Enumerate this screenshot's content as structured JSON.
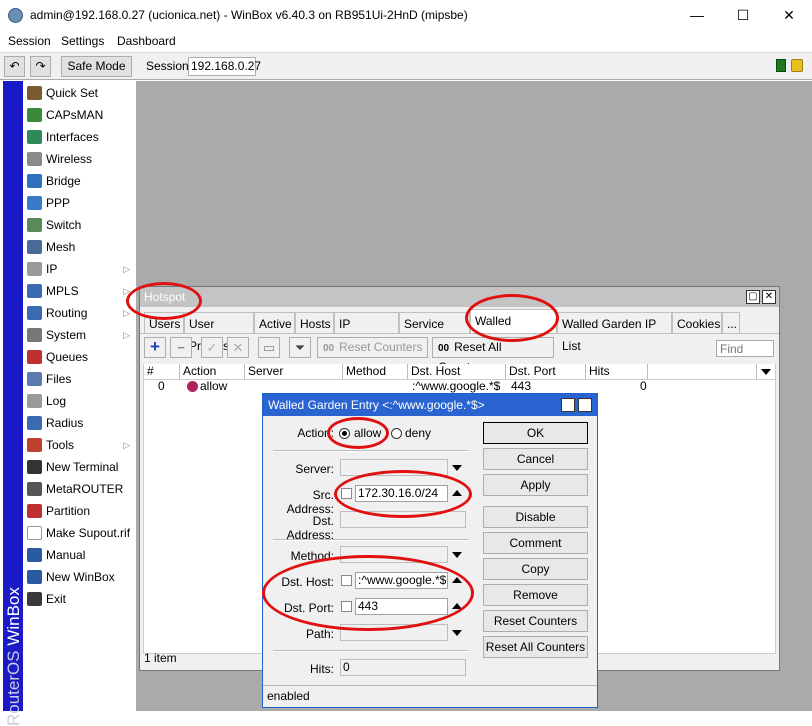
{
  "window": {
    "title": "admin@192.168.0.27 (ucionica.net) - WinBox v6.40.3 on RB951Ui-2HnD (mipsbe)",
    "minimize": "—",
    "maximize": "☐",
    "close": "✕"
  },
  "menubar": [
    "Session",
    "Settings",
    "Dashboard"
  ],
  "toolbar": {
    "undo": "↶",
    "redo": "↷",
    "safe_mode": "Safe Mode",
    "session_label": "Session:",
    "session_value": "192.168.0.27"
  },
  "sidebar": {
    "brand_a": "RouterOS ",
    "brand_b": "WinBox",
    "items": [
      {
        "label": "Quick Set",
        "icon": "quick-set-icon",
        "color": "#7a5a30",
        "submenu": false
      },
      {
        "label": "CAPsMAN",
        "icon": "capsman-icon",
        "color": "#3a8a3a",
        "submenu": false
      },
      {
        "label": "Interfaces",
        "icon": "interfaces-icon",
        "color": "#2e8b57",
        "submenu": false
      },
      {
        "label": "Wireless",
        "icon": "wireless-icon",
        "color": "#8a8a8a",
        "submenu": false
      },
      {
        "label": "Bridge",
        "icon": "bridge-icon",
        "color": "#3070c0",
        "submenu": false
      },
      {
        "label": "PPP",
        "icon": "ppp-icon",
        "color": "#3a7acb",
        "submenu": false
      },
      {
        "label": "Switch",
        "icon": "switch-icon",
        "color": "#5a8a5a",
        "submenu": false
      },
      {
        "label": "Mesh",
        "icon": "mesh-icon",
        "color": "#4a6a9a",
        "submenu": false
      },
      {
        "label": "IP",
        "icon": "ip-icon",
        "color": "#9a9a9a",
        "submenu": true
      },
      {
        "label": "MPLS",
        "icon": "mpls-icon",
        "color": "#3a6ab0",
        "submenu": true
      },
      {
        "label": "Routing",
        "icon": "routing-icon",
        "color": "#3a6ab0",
        "submenu": true
      },
      {
        "label": "System",
        "icon": "gear-icon",
        "color": "#777777",
        "submenu": true
      },
      {
        "label": "Queues",
        "icon": "queues-icon",
        "color": "#c03030",
        "submenu": false
      },
      {
        "label": "Files",
        "icon": "files-icon",
        "color": "#5a7ab0",
        "submenu": false
      },
      {
        "label": "Log",
        "icon": "log-icon",
        "color": "#9a9a9a",
        "submenu": false
      },
      {
        "label": "Radius",
        "icon": "radius-icon",
        "color": "#3a6ab0",
        "submenu": false
      },
      {
        "label": "Tools",
        "icon": "tools-icon",
        "color": "#c04030",
        "submenu": true
      },
      {
        "label": "New Terminal",
        "icon": "terminal-icon",
        "color": "#333333",
        "submenu": false
      },
      {
        "label": "MetaROUTER",
        "icon": "metarouter-icon",
        "color": "#555555",
        "submenu": false
      },
      {
        "label": "Partition",
        "icon": "partition-icon",
        "color": "#c03030",
        "submenu": false
      },
      {
        "label": "Make Supout.rif",
        "icon": "supout-icon",
        "color": "#ffffff",
        "submenu": false
      },
      {
        "label": "Manual",
        "icon": "manual-icon",
        "color": "#2a5aa0",
        "submenu": false
      },
      {
        "label": "New WinBox",
        "icon": "winbox-icon",
        "color": "#2a5aa0",
        "submenu": false
      },
      {
        "label": "Exit",
        "icon": "exit-icon",
        "color": "#3a3a3a",
        "submenu": false
      }
    ]
  },
  "hotspot": {
    "title": "Hotspot",
    "tabs": [
      "Users",
      "User Profiles",
      "Active",
      "Hosts",
      "IP Bindings",
      "Service Port",
      "Walled Garden",
      "Walled Garden IP List",
      "Cookies",
      "..."
    ],
    "active_tab": "Walled Garden",
    "toolbar": {
      "add": "+",
      "remove": "−",
      "enable": "✓",
      "disable": "✕",
      "comment": "▭",
      "filter": "⏷",
      "reset_counters": "Reset Counters",
      "reset_all_counters": "Reset All Counters",
      "counter_icon": "00",
      "find_placeholder": "Find"
    },
    "columns": [
      "#",
      "Action",
      "Server",
      "Method",
      "Dst. Host",
      "Dst. Port",
      "Hits"
    ],
    "rows": [
      {
        "num": "0",
        "action": "allow",
        "server": "",
        "method": "",
        "dst_host": ":^www.google.*$",
        "dst_port": "443",
        "hits": "0"
      }
    ],
    "status": "1 item"
  },
  "dialog": {
    "title": "Walled Garden Entry <:^www.google.*$>",
    "action_label": "Action:",
    "action_allow": "allow",
    "action_deny": "deny",
    "server_label": "Server:",
    "server_value": "",
    "src_address_label": "Src. Address:",
    "src_address_value": "172.30.16.0/24",
    "dst_address_label": "Dst. Address:",
    "dst_address_value": "",
    "method_label": "Method:",
    "method_value": "",
    "dst_host_label": "Dst. Host:",
    "dst_host_value": ":^www.google.*$",
    "dst_port_label": "Dst. Port:",
    "dst_port_value": "443",
    "path_label": "Path:",
    "path_value": "",
    "hits_label": "Hits:",
    "hits_value": "0",
    "status": "enabled",
    "buttons": [
      "OK",
      "Cancel",
      "Apply",
      "Disable",
      "Comment",
      "Copy",
      "Remove",
      "Reset Counters",
      "Reset All Counters"
    ]
  }
}
